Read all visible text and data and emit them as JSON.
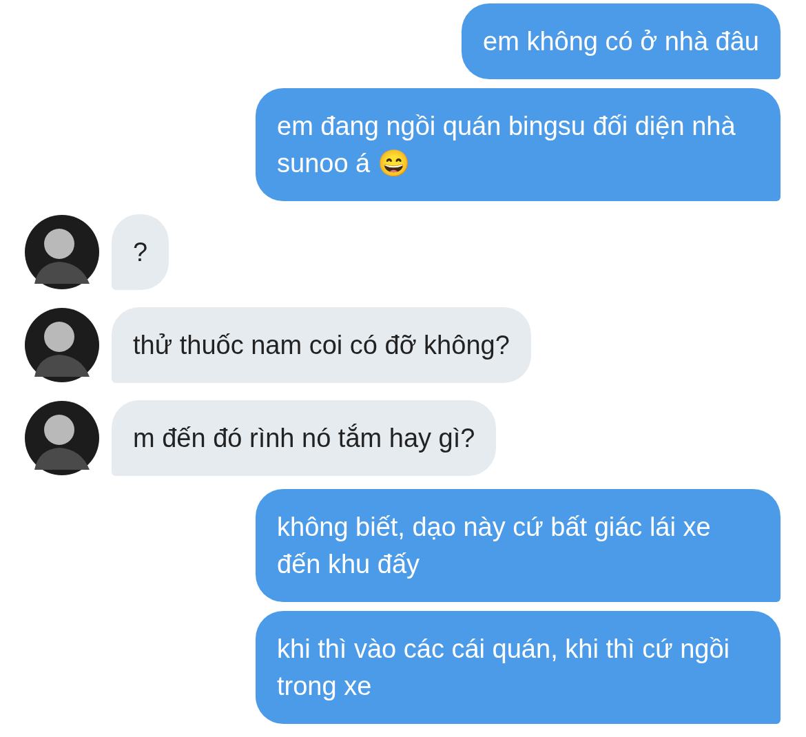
{
  "messages": [
    {
      "kind": "sent",
      "text": "em không có ở nhà đâu"
    },
    {
      "kind": "sent",
      "text": "em đang ngồi quán bingsu đối diện nhà sunoo á 😄"
    },
    {
      "kind": "received",
      "text": "?"
    },
    {
      "kind": "received",
      "text": "thử thuốc nam coi có đỡ không?"
    },
    {
      "kind": "received",
      "text": "m đến đó rình nó tắm hay gì?"
    },
    {
      "kind": "sent",
      "text": "không biết, dạo này cứ bất giác lái xe đến khu đấy"
    },
    {
      "kind": "sent",
      "text": "khi thì vào các cái quán, khi thì cứ ngồi trong xe"
    }
  ]
}
